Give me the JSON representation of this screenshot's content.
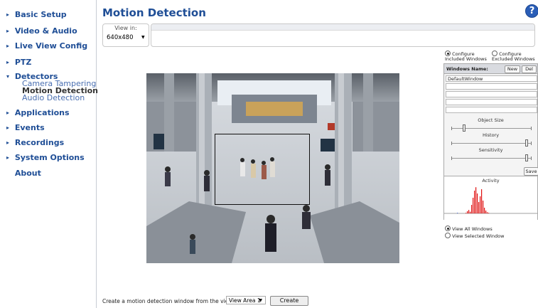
{
  "sidebar": {
    "items": [
      {
        "label": "Basic Setup",
        "arrow": "▸"
      },
      {
        "label": "Video & Audio",
        "arrow": "▸"
      },
      {
        "label": "Live View Config",
        "arrow": "▸"
      },
      {
        "label": "PTZ",
        "arrow": "▸"
      },
      {
        "label": "Detectors",
        "arrow": "▾"
      },
      {
        "label": "Applications",
        "arrow": "▸"
      },
      {
        "label": "Events",
        "arrow": "▸"
      },
      {
        "label": "Recordings",
        "arrow": "▸"
      },
      {
        "label": "System Options",
        "arrow": "▸"
      },
      {
        "label": "About",
        "arrow": ""
      }
    ],
    "detectors_sub": [
      {
        "label": "Camera Tampering"
      },
      {
        "label": "Motion Detection",
        "active": true
      },
      {
        "label": "Audio Detection"
      }
    ]
  },
  "header": {
    "title": "Motion Detection",
    "help_glyph": "?"
  },
  "view_in": {
    "label": "View in:",
    "selected": "640x480",
    "chevron": "▼"
  },
  "config": {
    "included_label": "Configure Included Windows",
    "excluded_label": "Configure Excluded Windows",
    "included_selected": true
  },
  "windows": {
    "header": "Windows Name:",
    "new_label": "New",
    "del_label": "Del",
    "rows": [
      "DefaultWindow",
      "",
      "",
      "",
      ""
    ]
  },
  "sliders": {
    "object_size": {
      "label": "Object Size",
      "level": 0.15
    },
    "history": {
      "label": "History",
      "level": 0.95
    },
    "sensitivity": {
      "label": "Sensitivity",
      "level": 0.95
    }
  },
  "save_label": "Save",
  "activity": {
    "title": "Activity",
    "bars": [
      2,
      0,
      0,
      0,
      0,
      0,
      2,
      8,
      12,
      6,
      30,
      55,
      80,
      92,
      70,
      40,
      60,
      85,
      45,
      20,
      10,
      4,
      2
    ]
  },
  "view_options": {
    "all_label": "View All Windows",
    "selected_label": "View Selected Window",
    "all_selected": true
  },
  "bottom": {
    "label": "Create a motion detection window from the view area",
    "area_value": "View Area 1",
    "chevron": "▼",
    "create_label": "Create"
  },
  "colors": {
    "nav_blue": "#1f4e96",
    "activity_red": "#e01010"
  }
}
